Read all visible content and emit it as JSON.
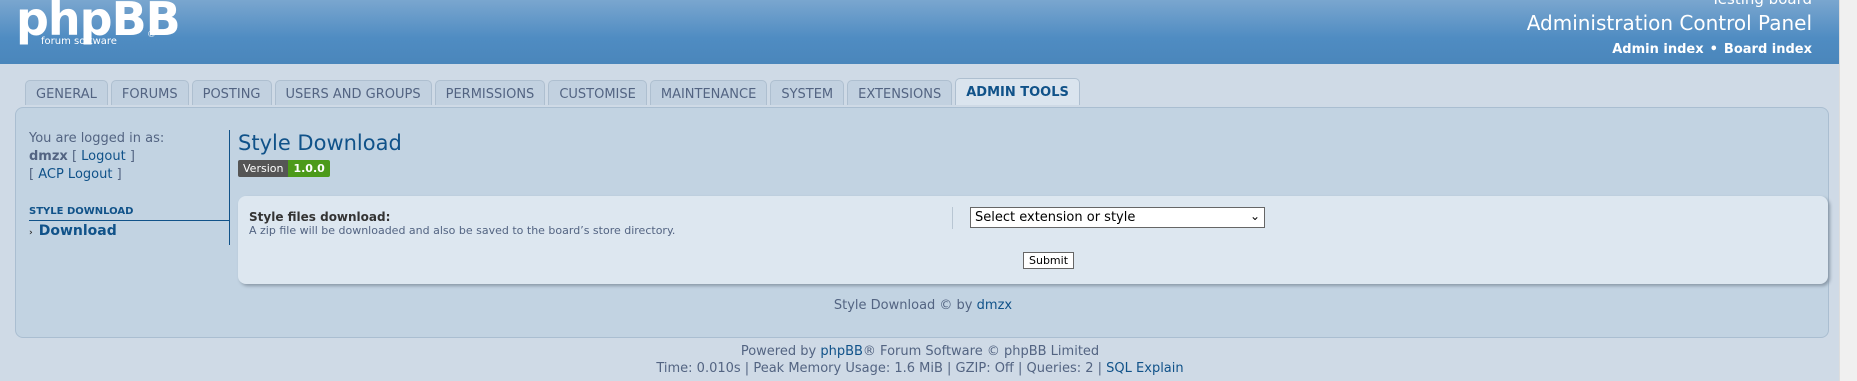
{
  "header": {
    "logo_text": "phpBB",
    "logo_subtext": "forum software",
    "logo_registered": "®",
    "board_name": "Testing board",
    "acp_title": "Administration Control Panel",
    "admin_index": "Admin index",
    "board_index": "Board index",
    "bullet": "•"
  },
  "tabs": [
    {
      "label": "GENERAL"
    },
    {
      "label": "FORUMS"
    },
    {
      "label": "POSTING"
    },
    {
      "label": "USERS AND GROUPS"
    },
    {
      "label": "PERMISSIONS"
    },
    {
      "label": "CUSTOMISE"
    },
    {
      "label": "MAINTENANCE"
    },
    {
      "label": "SYSTEM"
    },
    {
      "label": "EXTENSIONS"
    },
    {
      "label": "ADMIN TOOLS"
    }
  ],
  "menu": {
    "logged_in_as": "You are logged in as:",
    "username": "dmzx",
    "logout": "Logout",
    "acp_logout": "ACP Logout",
    "section_heading": "STYLE DOWNLOAD",
    "item_label": "Download"
  },
  "main": {
    "title": "Style Download",
    "version_label": "Version",
    "version_number": "1.0.0",
    "field_label": "Style files download:",
    "field_explain": "A zip file will be downloaded and also be saved to the board’s store directory.",
    "select_value": "Select extension or style",
    "submit_label": "Submit",
    "credit_prefix": "Style Download © by",
    "credit_author": "dmzx"
  },
  "footer": {
    "powered_prefix": "Powered by",
    "phpbb_link": "phpBB",
    "powered_suffix": "® Forum Software © phpBB Limited",
    "stats": "Time: 0.010s | Peak Memory Usage: 1.6 MiB | GZIP: Off | Queries: 2 |",
    "sql_explain": "SQL Explain"
  }
}
